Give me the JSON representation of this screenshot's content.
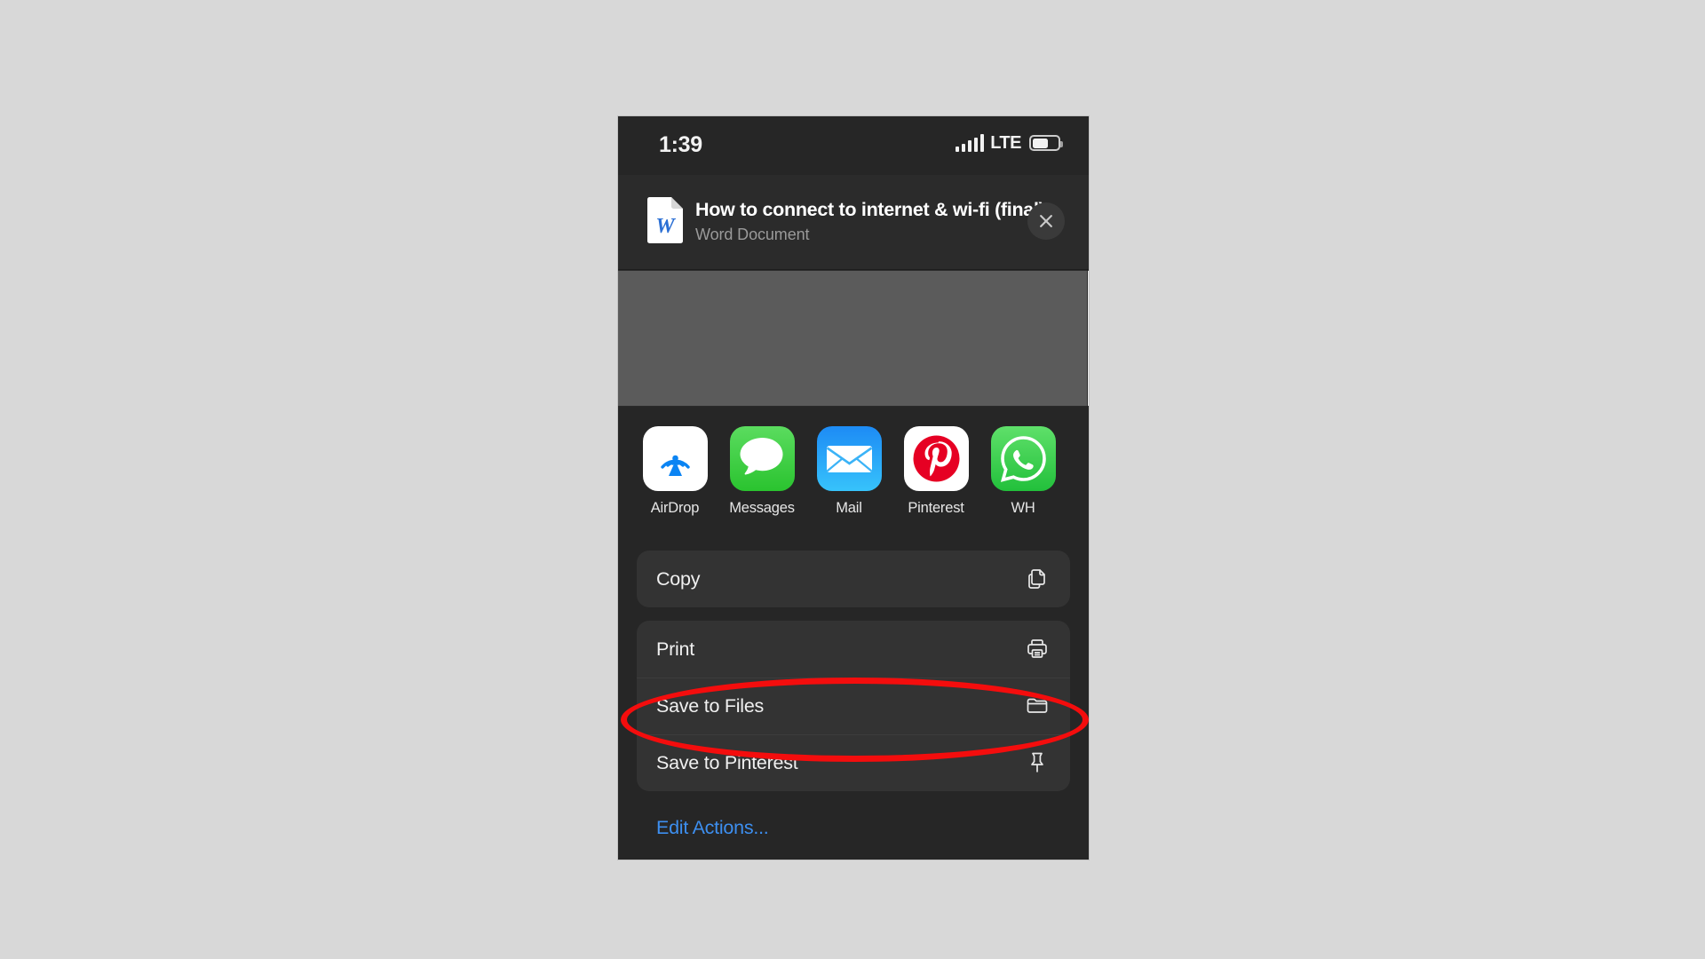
{
  "status_bar": {
    "time": "1:39",
    "network_label": "LTE",
    "signal_icon": "cellular-signal-icon",
    "battery_icon": "battery-icon",
    "battery_level_percent": 56
  },
  "document_header": {
    "file_icon": "word-document-icon",
    "title": "How to connect to internet & wi-fi (final)",
    "subtitle": "Word Document",
    "close_icon": "close-icon"
  },
  "preview": {
    "card_label": "document-preview-thumbnail",
    "next_card_label": "document-preview-thumbnail-next"
  },
  "share_apps": [
    {
      "label": "AirDrop",
      "icon": "airdrop-icon"
    },
    {
      "label": "Messages",
      "icon": "messages-icon"
    },
    {
      "label": "Mail",
      "icon": "mail-icon"
    },
    {
      "label": "Pinterest",
      "icon": "pinterest-icon"
    },
    {
      "label": "WH",
      "icon": "whatsapp-icon"
    }
  ],
  "action_groups": [
    {
      "rows": [
        {
          "label": "Copy",
          "icon": "copy-icon",
          "highlighted": false
        }
      ]
    },
    {
      "rows": [
        {
          "label": "Print",
          "icon": "printer-icon",
          "highlighted": false
        },
        {
          "label": "Save to Files",
          "icon": "folder-icon",
          "highlighted": true
        },
        {
          "label": "Save to Pinterest",
          "icon": "pin-icon",
          "highlighted": false
        }
      ]
    }
  ],
  "edit_actions": {
    "label": "Edit Actions...",
    "color": "#3d8ff0"
  },
  "annotation": {
    "type": "ellipse",
    "color": "#f40d0d",
    "targets": "Save to Files"
  },
  "colors": {
    "page_background": "#d8d8d8",
    "sheet_background": "#262626",
    "card_background": "#333333",
    "accent_blue": "#3d8ff0",
    "annotation_red": "#f40d0d"
  }
}
